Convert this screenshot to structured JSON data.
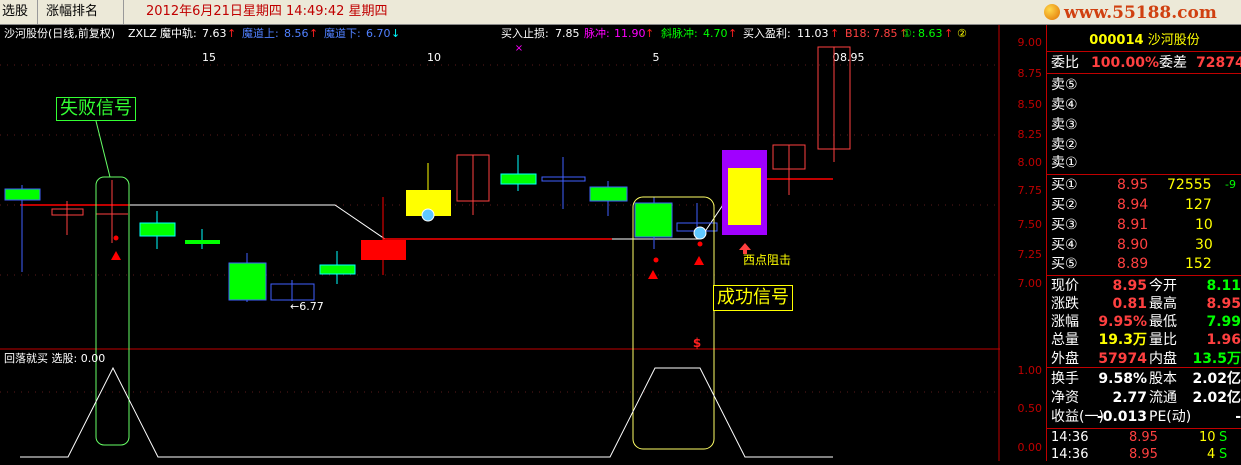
{
  "menu": {
    "tab1": "选股",
    "tab2": "涨幅排名",
    "datetime": "2012年6月21日星期四  14:49:42 星期四"
  },
  "logo": "www.55188.com",
  "chart_header": {
    "title": "沙河股份(日线,前复权)",
    "indicator": "ZXLZ",
    "mid_label": "魔中轨:",
    "mid_value": "7.63",
    "up_label": "魔道上:",
    "up_value": "8.56",
    "down_label": "魔道下:",
    "down_value": "6.70",
    "stop_label": "买入止损:",
    "stop_value": "7.85",
    "pulse_label": "脉冲:",
    "pulse_value": "11.90",
    "slant_label": "斜脉冲:",
    "slant_value": "4.70",
    "profit_label": "买入盈利:",
    "profit_value": "11.03",
    "b18_label": "B18:",
    "b18_value": "7.85",
    "one_label": "①:",
    "one_value": "8.63",
    "two_label": "②"
  },
  "day_markers": [
    "15",
    "10",
    "5",
    "0"
  ],
  "high_label": "8.95",
  "low_label": "←6.77",
  "annotations": {
    "fail": "失败信号",
    "success": "成功信号",
    "resist": "西点阻击",
    "dollar": "$"
  },
  "sub_header": "回落就买  选股: 0.00",
  "price_ticks": [
    "9.00",
    "8.75",
    "8.50",
    "8.25",
    "8.00",
    "7.75",
    "7.50",
    "7.25",
    "7.00"
  ],
  "sub_ticks": [
    "1.00",
    "0.50",
    "0.00"
  ],
  "colors": {
    "up": "#ff0000",
    "down": "#00ff00",
    "red_text": "#ff4040",
    "yellow": "#ffff00",
    "cyan": "#00ffff",
    "blue": "#4060ff",
    "magenta": "#ff00ff"
  },
  "quote": {
    "code": "000014",
    "name": "沙河股份",
    "wb_label": "委比",
    "wb_value": "100.00%",
    "wc_label": "委差",
    "wc_value": "72874",
    "sells": [
      "卖⑤",
      "卖④",
      "卖③",
      "卖②",
      "卖①"
    ],
    "buys": [
      {
        "label": "买①",
        "price": "8.95",
        "vol": "72555",
        "chg": "-9"
      },
      {
        "label": "买②",
        "price": "8.94",
        "vol": "127",
        "chg": ""
      },
      {
        "label": "买③",
        "price": "8.91",
        "vol": "10",
        "chg": ""
      },
      {
        "label": "买④",
        "price": "8.90",
        "vol": "30",
        "chg": ""
      },
      {
        "label": "买⑤",
        "price": "8.89",
        "vol": "152",
        "chg": ""
      }
    ],
    "stats": [
      {
        "l1": "现价",
        "v1": "8.95",
        "l2": "今开",
        "v2": "8.11"
      },
      {
        "l1": "涨跌",
        "v1": "0.81",
        "l2": "最高",
        "v2": "8.95"
      },
      {
        "l1": "涨幅",
        "v1": "9.95%",
        "l2": "最低",
        "v2": "7.99"
      },
      {
        "l1": "总量",
        "v1": "19.3万",
        "l2": "量比",
        "v2": "1.96"
      },
      {
        "l1": "外盘",
        "v1": "57974",
        "l2": "内盘",
        "v2": "13.5万"
      },
      {
        "l1": "换手",
        "v1": "9.58%",
        "l2": "股本",
        "v2": "2.02亿"
      },
      {
        "l1": "净资",
        "v1": "2.77",
        "l2": "流通",
        "v2": "2.02亿"
      },
      {
        "l1": "收益(一)",
        "v1": "-0.013",
        "l2": "PE(动)",
        "v2": "-"
      }
    ],
    "ticks": [
      {
        "time": "14:36",
        "price": "8.95",
        "vol": "10",
        "side": "S"
      },
      {
        "time": "14:36",
        "price": "8.95",
        "vol": "4",
        "side": "S"
      }
    ]
  }
}
